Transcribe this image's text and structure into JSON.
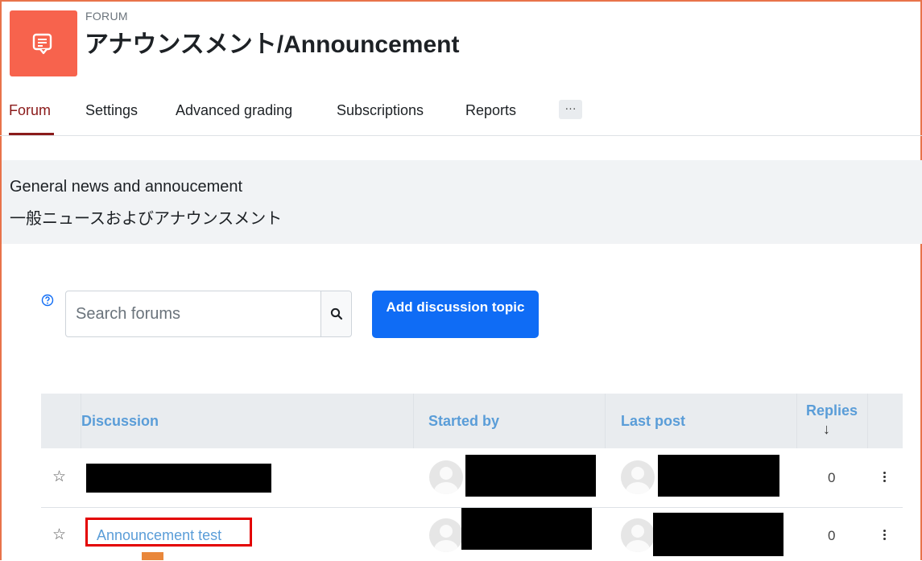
{
  "header": {
    "pretitle": "FORUM",
    "title": "アナウンスメント/Announcement",
    "icon": "forum-icon"
  },
  "tabs": [
    {
      "label": "Forum",
      "active": true
    },
    {
      "label": "Settings",
      "active": false
    },
    {
      "label": "Advanced grading",
      "active": false
    },
    {
      "label": "Subscriptions",
      "active": false
    },
    {
      "label": "Reports",
      "active": false
    }
  ],
  "more_tab_label": "···",
  "intro": {
    "line1": "General news and annoucement",
    "line2": "一般ニュースおよびアナウンスメント"
  },
  "search": {
    "placeholder": "Search forums",
    "help_icon": "question-circle-icon",
    "button_icon": "search-icon"
  },
  "add_button_label": "Add discussion topic",
  "table": {
    "headers": {
      "discussion": "Discussion",
      "started_by": "Started by",
      "last_post": "Last post",
      "replies": "Replies",
      "sort_indicator": "↓"
    },
    "rows": [
      {
        "title": "",
        "replies": "0",
        "redacted": true
      },
      {
        "title": "Announcement test",
        "replies": "0",
        "redacted": false
      }
    ]
  },
  "colors": {
    "accent": "#0f6cf5",
    "forum_icon_bg": "#f7634d",
    "active_tab": "#8a1a1a",
    "link": "#5a9dd8",
    "highlight_box": "#e30000"
  }
}
